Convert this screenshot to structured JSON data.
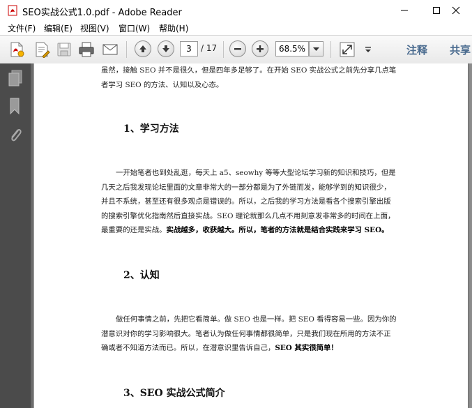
{
  "window": {
    "title": "SEO实战公式1.0.pdf - Adobe Reader"
  },
  "menu": {
    "items": [
      "文件(F)",
      "编辑(E)",
      "视图(V)",
      "窗口(W)",
      "帮助(H)"
    ]
  },
  "toolbar": {
    "page_current": "3",
    "page_total": "/ 17",
    "zoom": "68.5%",
    "annotate_label": "注释",
    "share_label": "共享"
  },
  "document": {
    "intro_line1": "虽然，接触 SEO 并不是很久，但是四年多足够了。在开始 SEO 实战公式之前先分享几点笔",
    "intro_line2": "者学习 SEO 的方法、认知以及心态。",
    "section1": {
      "heading": "1、学习方法",
      "line1": "一开始笔者也到处乱逛，每天上 a5、seowhy 等等大型论坛学习新的知识和技巧，但是",
      "line2": "几天之后我发现论坛里面的文章非常大的一部分都是为了外链而发，能够学到的知识很少，",
      "line3": "并且不系统，甚至还有很多观点是错误的。所以，之后我的学习方法是看各个搜索引擎出版",
      "line4": "的搜索引擎优化指南然后直接实战。SEO 理论就那么几点不用刻意发非常多的时间在上面，",
      "line5_normal": "最重要的还是实战。",
      "line5_bold": "实战越多，收获越大。所以，笔者的方法就是结合实践来学习 SEO。"
    },
    "section2": {
      "heading": "2、认知",
      "line1": "做任何事情之前，先把它看简单。做 SEO 也是一样。把 SEO 看得容易一些。因为你的",
      "line2": "潜意识对你的学习影响很大。笔者认为做任何事情都很简单，只是我们现在所用的方法不正",
      "line3_normal": "确或者不知道方法而已。所以，在潜意识里告诉自己，",
      "line3_bold": "SEO 其实很简单！"
    },
    "section3": {
      "heading": "3、SEO 实战公式简介"
    }
  }
}
